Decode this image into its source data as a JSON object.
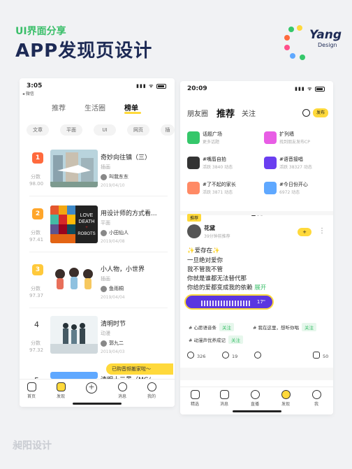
{
  "header": {
    "subtitle": "UI界面分享",
    "title": "APP发现页设计",
    "logo_text": "Yang",
    "logo_sub": "Design"
  },
  "footer": "昶阳设计",
  "phone1": {
    "time": "3:05",
    "carrier": "◂ 微信",
    "tabs": [
      "推荐",
      "生活圈",
      "榜单"
    ],
    "chips": [
      "文章",
      "平面",
      "UI",
      "网页",
      "插"
    ],
    "items": [
      {
        "rank": "1",
        "score_label": "分数",
        "score": "98.00",
        "title": "奇妙向往镇（三）",
        "category": "插画",
        "author": "叫我东东",
        "date": "2019/04/10",
        "badge_color": "#ff6a3d"
      },
      {
        "rank": "2",
        "score_label": "分数",
        "score": "97.41",
        "title": "用设计师的方式看...",
        "category": "平面",
        "author": "小田仙人",
        "date": "2019/04/08",
        "badge_color": "#ffa62b",
        "poster": "LOVE DEATH + ROBOTS"
      },
      {
        "rank": "3",
        "score_label": "分数",
        "score": "97.37",
        "title": "小人物，小世界",
        "category": "插画",
        "author": "鱼雨桐",
        "date": "2019/04/04",
        "badge_color": "#ffc93b"
      },
      {
        "rank": "4",
        "score_label": "分数",
        "score": "97.32",
        "title": "清明时节",
        "category": "动漫",
        "author": "郭九二",
        "date": "2019/04/03"
      },
      {
        "rank": "5",
        "score_label": "",
        "score": "",
        "title": "清明十二景（MG/",
        "category": "",
        "author": "",
        "date": ""
      }
    ],
    "toast": "已购音频搬家啦～",
    "tabbar": [
      "首页",
      "发现",
      "",
      "消息",
      "我的"
    ]
  },
  "phone2": {
    "time": "20:09",
    "tabs": [
      "朋友圈",
      "推荐",
      "关注"
    ],
    "publish": "发布",
    "topics": [
      {
        "name": "话题广场",
        "desc": "更多话题",
        "color": "#35c76a"
      },
      {
        "name": "扩列墙",
        "desc": "找到朋友发布CP",
        "color": "#e85de5"
      },
      {
        "name": "#嘴唇自拍",
        "desc": "活跃 3840 动态",
        "color": "#333"
      },
      {
        "name": "#语音接唱",
        "desc": "活跃 38327 动态",
        "color": "#6a3ef0"
      },
      {
        "name": "#了不起的家长",
        "desc": "活跃 3871 动态",
        "color": "#ff8a65"
      },
      {
        "name": "#今日份开心",
        "desc": "6972 动态",
        "color": "#5fa8ff"
      }
    ],
    "post": {
      "tag": "推荐",
      "user": "花黛",
      "time": "39分钟前推荐",
      "follow": "+",
      "lines": [
        "✨爱存在✨",
        "一旦绝对爱你",
        "我不管我不管",
        "你就是谁都无法替代那",
        "你给的爱都变成我的依赖"
      ],
      "expand": "展开",
      "duration": "17\"",
      "hashtags": [
        {
          "text": "# 心愿语音条",
          "follow": "关注"
        },
        {
          "text": "# 我在这里，想听你唱",
          "follow": "关注"
        },
        {
          "text": "# 动漫声优养成记",
          "follow": "关注"
        }
      ],
      "likes": "326",
      "comments": "19",
      "shares": "",
      "saves": "50"
    },
    "tabbar": [
      "精选",
      "消息",
      "直播",
      "发现",
      "我"
    ]
  }
}
